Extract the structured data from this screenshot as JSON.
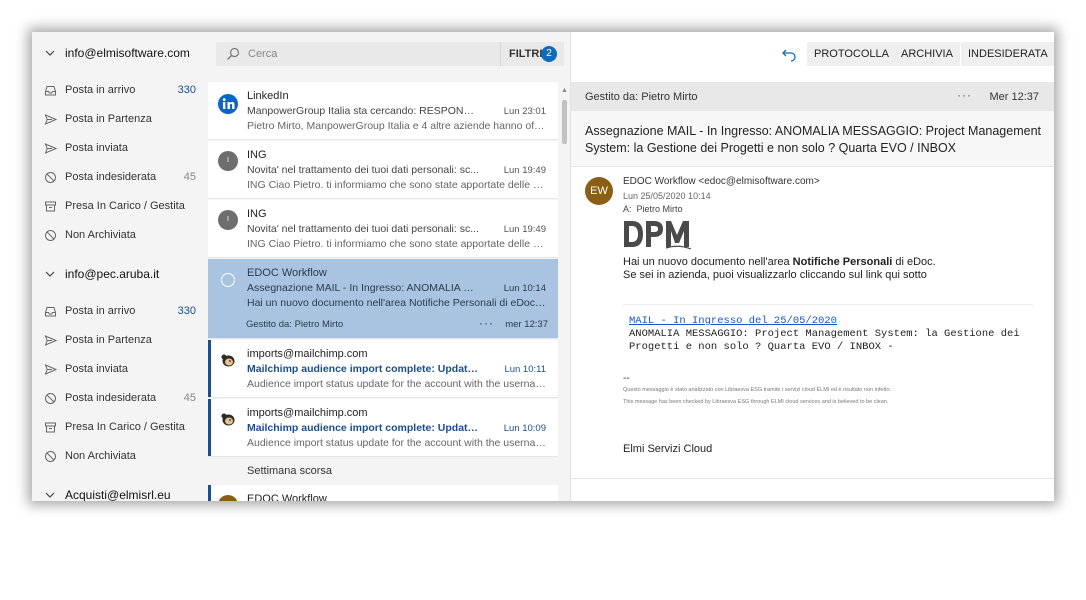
{
  "sidebar": {
    "accounts": [
      {
        "name": "info@elmisoftware.com",
        "folders": [
          {
            "label": "Posta in arrivo",
            "icon": "inbox-icon",
            "count": "330"
          },
          {
            "label": "Posta in Partenza",
            "icon": "send-icon",
            "count": ""
          },
          {
            "label": "Posta inviata",
            "icon": "send-icon",
            "count": ""
          },
          {
            "label": "Posta indesiderata",
            "icon": "block-icon",
            "count": "45"
          },
          {
            "label": "Presa In Carico / Gestita",
            "icon": "archive-icon",
            "count": ""
          },
          {
            "label": "Non Archiviata",
            "icon": "block-icon",
            "count": ""
          }
        ]
      },
      {
        "name": "info@pec.aruba.it",
        "folders": [
          {
            "label": "Posta in arrivo",
            "icon": "inbox-icon",
            "count": "330"
          },
          {
            "label": "Posta in Partenza",
            "icon": "send-icon",
            "count": ""
          },
          {
            "label": "Posta inviata",
            "icon": "send-icon",
            "count": ""
          },
          {
            "label": "Posta indesiderata",
            "icon": "block-icon",
            "count": "45"
          },
          {
            "label": "Presa In Carico / Gestita",
            "icon": "archive-icon",
            "count": ""
          },
          {
            "label": "Non Archiviata",
            "icon": "block-icon",
            "count": ""
          }
        ]
      },
      {
        "name": "Acquisti@elmisrl.eu",
        "folders": []
      }
    ]
  },
  "list": {
    "search_placeholder": "Cerca",
    "filter_label": "FILTRI",
    "filter_count": "2",
    "messages": [
      {
        "sender": "LinkedIn",
        "subject": "ManpowerGroup Italia sta cercando: RESPONSAB...",
        "time": "Lun 23:01",
        "preview": "Pietro Mirto, ManpowerGroup Italia e 4 altre aziende hanno offer...",
        "avatar": "linkedin-icon",
        "unread": false,
        "selected": false
      },
      {
        "sender": "ING",
        "subject": "Novita' nel trattamento dei tuoi dati personali: sc...",
        "time": "Lun 19:49",
        "preview": "ING Ciao Pietro. ti informiamo che sono state apportate delle mo...",
        "avatar": "initial-avatar",
        "avatar_text": "I",
        "unread": false,
        "selected": false
      },
      {
        "sender": "ING",
        "subject": "Novita' nel trattamento dei tuoi dati personali: sc...",
        "time": "Lun 19:49",
        "preview": "ING Ciao Pietro. ti informiamo che sono state apportate delle mo...",
        "avatar": "initial-avatar",
        "avatar_text": "I",
        "unread": false,
        "selected": false
      },
      {
        "sender": "EDOC Workflow",
        "subject": "Assegnazione MAIL - In Ingresso: ANOMALIA ME...",
        "time": "Lun 10:14",
        "preview": "Hai un nuovo documento nell'area Notifiche Personali di eDoc. S...",
        "avatar": "radio-icon",
        "unread": false,
        "selected": true,
        "managed": "Gestito da: Pietro Mirto",
        "managed_time": "mer 12:37"
      },
      {
        "sender": "imports@mailchimp.com",
        "subject": "Mailchimp audience import complete: Updated ...",
        "time": "Lun 10:11",
        "preview": "Audience import status update for the account with the usernam...",
        "avatar": "mailchimp-icon",
        "unread": true,
        "selected": false
      },
      {
        "sender": "imports@mailchimp.com",
        "subject": "Mailchimp audience import complete: Updated ...",
        "time": "Lun 10:09",
        "preview": "Audience import status update for the account with the usernam...",
        "avatar": "mailchimp-icon",
        "unread": true,
        "selected": false
      }
    ],
    "section_label": "Settimana scorsa",
    "partial_sender": "EDOC Workflow",
    "dots": "···"
  },
  "reading": {
    "toolbar": {
      "protocol_label": "PROTOCOLLA",
      "archive_label": "ARCHIVIA",
      "junk_label": "INDESIDERATA"
    },
    "managed_by": "Gestito da: Pietro Mirto",
    "managed_dots": "···",
    "managed_time": "Mer 12:37",
    "subject": "Assegnazione MAIL - In Ingresso: ANOMALIA MESSAGGIO: Project Management System: la Gestione dei Progetti e non solo ? Quarta EVO / INBOX",
    "avatar_initials": "EW",
    "avatar_color": "#8a5e13",
    "from": "EDOC Workflow <edoc@elmisoftware.com>",
    "date": "Lun 25/05/2020 10:14",
    "to_label": "A:",
    "to": "Pietro Mirto",
    "logo_text": "DPM",
    "intro_before": "Hai un nuovo documento nell'area ",
    "intro_bold": "Notifiche Personali",
    "intro_after": " di eDoc.",
    "intro_line2": "Se sei in azienda, puoi visualizzarlo cliccando sul link qui sotto",
    "link_text": "MAIL - In Ingresso del 25/05/2020",
    "mono_line1": "ANOMALIA MESSAGGIO: Project Management System: la Gestione dei",
    "mono_line2": "Progetti e non solo ? Quarta EVO / INBOX -",
    "dashes": "--",
    "tiny_line1": "Questo messaggio è stato analizzato con Libraesva ESG  tramite i servizi cloud ELMI ed è risultato non infetto.",
    "tiny_line2": "This message has been checked by Libraesva ESG  through ELMI cloud services  and is believed to be clean.",
    "signature": "Elmi Servizi Cloud"
  },
  "colors": {
    "accent": "#0f6cbd",
    "selected_row": "#a9c4e0",
    "unread_bar": "#1a4f8b",
    "linkedin": "#0a66c2",
    "ing_avatar": "#6e6e6e"
  }
}
